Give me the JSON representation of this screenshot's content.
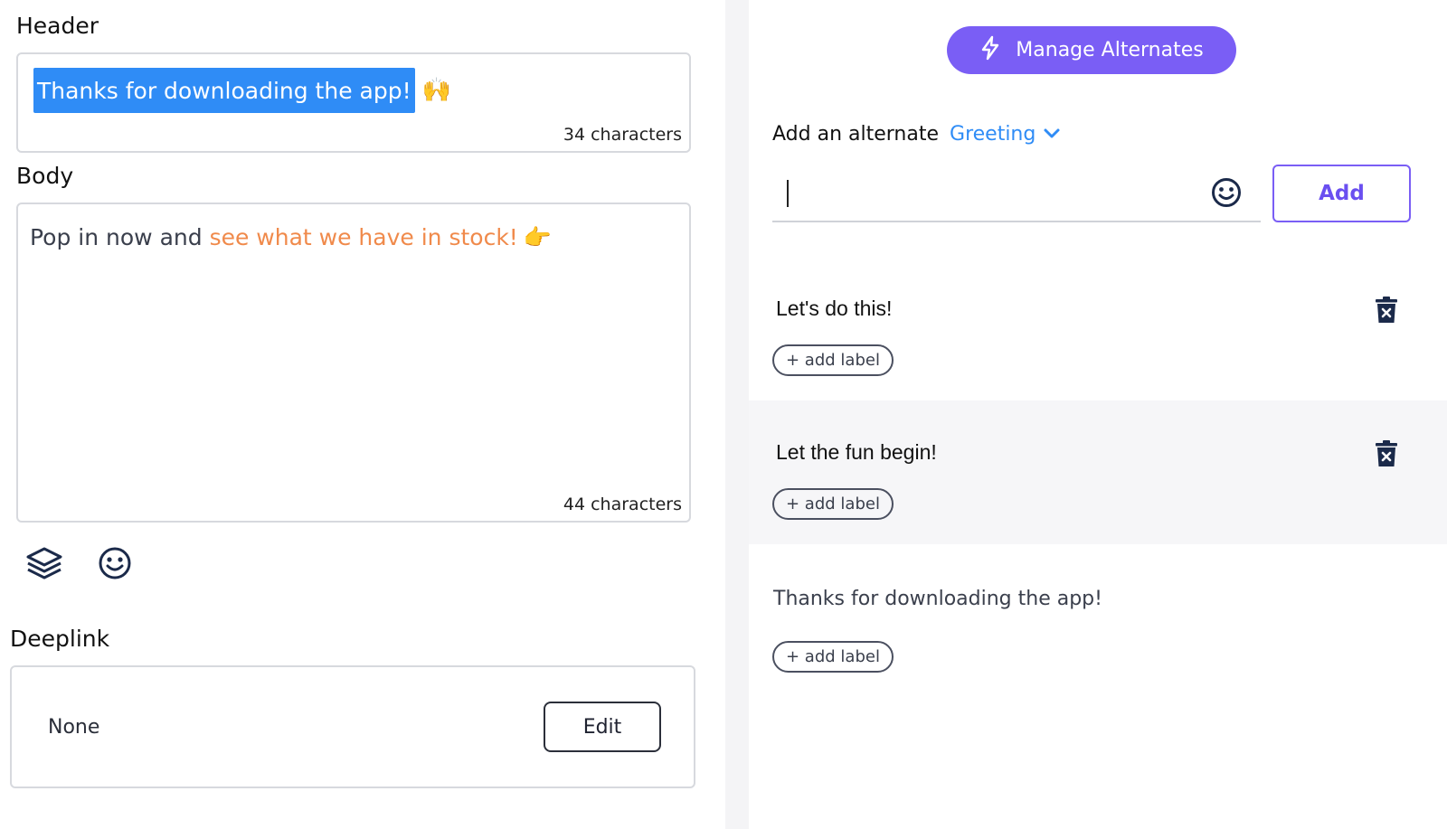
{
  "colors": {
    "accent_purple": "#7a5ef5",
    "highlight_blue": "#2f8cf6",
    "body_accent_orange": "#f08a4b",
    "divider_gray": "#f4f4f6"
  },
  "left": {
    "header": {
      "title": "Header",
      "selected_text": "Thanks for downloading the app!",
      "emoji": "🙌",
      "char_count": "34 characters"
    },
    "body": {
      "title": "Body",
      "text_plain": "Pop in now and ",
      "text_accent": "see what we have in stock!",
      "emoji": "👉",
      "char_count": "44 characters"
    },
    "toolbar": {
      "layers_icon": "layers-icon",
      "emoji_icon": "smiley-icon"
    },
    "deeplink": {
      "title": "Deeplink",
      "value": "None",
      "edit_label": "Edit"
    }
  },
  "right": {
    "manage_button": {
      "icon": "lightning-icon",
      "label": "Manage Alternates"
    },
    "add_alternate": {
      "label": "Add an alternate",
      "type_value": "Greeting",
      "input_value": "",
      "add_label": "Add"
    },
    "alternates": [
      {
        "text": "Let's do this!",
        "label_button": "+ add label",
        "deletable": true
      },
      {
        "text": "Let the fun begin!",
        "label_button": "+ add label",
        "deletable": true
      },
      {
        "text": "Thanks for downloading the app!",
        "label_button": "+ add label",
        "deletable": false
      }
    ]
  }
}
